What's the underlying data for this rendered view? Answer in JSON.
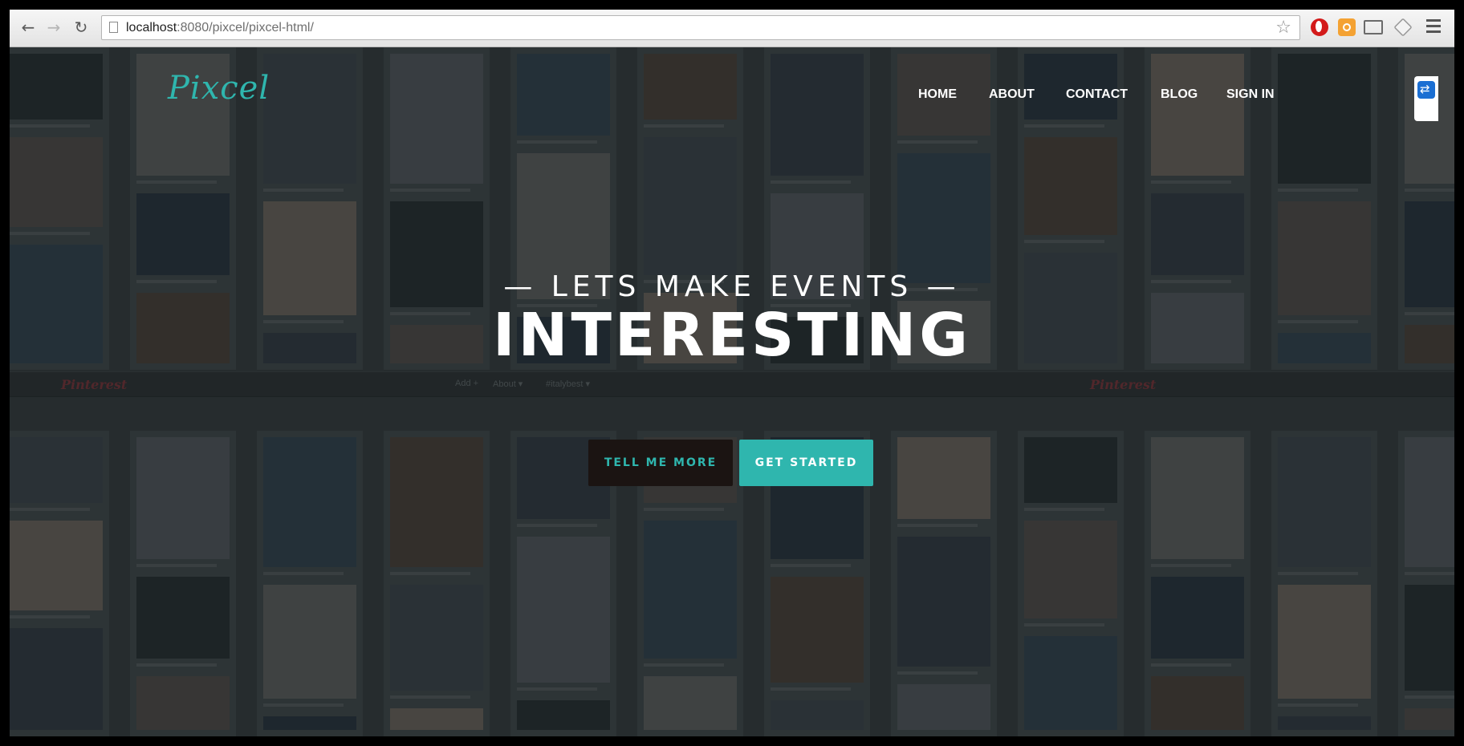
{
  "browser": {
    "url_host": "localhost",
    "url_rest": ":8080/pixcel/pixcel-html/",
    "icons": [
      "back-icon",
      "forward-icon",
      "reload-icon",
      "page-icon",
      "star-icon",
      "opera-icon",
      "extension-icon",
      "cast-icon",
      "cube-icon",
      "menu-icon"
    ]
  },
  "site": {
    "logo": "Pixcel",
    "nav": [
      "HOME",
      "ABOUT",
      "CONTACT",
      "BLOG",
      "SIGN IN"
    ],
    "hero_subtitle": "— LETS MAKE EVENTS —",
    "hero_title": "INTERESTING",
    "buttons": {
      "more": "TELL ME MORE",
      "start": "GET STARTED"
    },
    "colors": {
      "accent": "#2fb6ae",
      "dark_button": "#1b1412",
      "text": "#ffffff"
    }
  },
  "background": {
    "pinterest_logo": "Pinterest",
    "links": [
      "Add +",
      "About ▾",
      "#italybest ▾"
    ]
  }
}
